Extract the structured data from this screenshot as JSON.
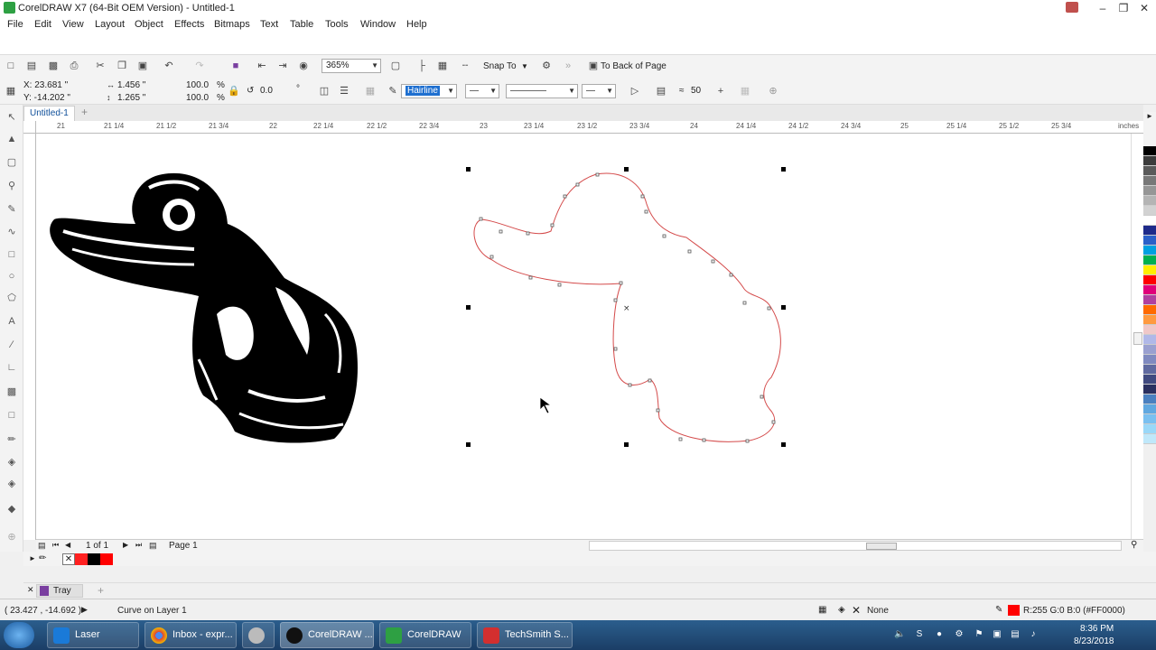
{
  "window": {
    "title": "CorelDRAW X7 (64-Bit OEM Version) - Untitled-1"
  },
  "menu": [
    "File",
    "Edit",
    "View",
    "Layout",
    "Object",
    "Effects",
    "Bitmaps",
    "Text",
    "Table",
    "Tools",
    "Window",
    "Help"
  ],
  "toolbar": {
    "zoom": "365%",
    "snap_to": "Snap To",
    "to_back": "To Back of Page"
  },
  "property_bar": {
    "x": "X: 23.681 \"",
    "y": "Y: -14.202 \"",
    "w": "1.456 \"",
    "h": "1.265 \"",
    "scale_x": "100.0",
    "scale_y": "100.0",
    "pct": "%",
    "rotation": "0.0",
    "deg": "°",
    "outline_width": "Hairline",
    "smooth": "50"
  },
  "doc_tab": "Untitled-1",
  "ruler": {
    "h_ticks": [
      "21",
      "21 1/4",
      "21 1/2",
      "21 3/4",
      "22",
      "22 1/4",
      "22 1/2",
      "22 3/4",
      "23",
      "23 1/4",
      "23 1/2",
      "23 3/4",
      "24",
      "24 1/4",
      "24 1/2",
      "24 3/4",
      "25",
      "25 1/4",
      "25 1/2",
      "25 3/4"
    ],
    "unit": "inches"
  },
  "page_nav": {
    "counter": "1 of 1",
    "page": "Page 1"
  },
  "tray": {
    "label": "Tray"
  },
  "status": {
    "coords": "( 23.427 , -14.692 )",
    "object": "Curve on Layer 1",
    "fill": "None",
    "outline": "R:255 G:0 B:0 (#FF0000)"
  },
  "taskbar": {
    "items": [
      "Laser Engravi...",
      "Inbox - expr...",
      "CorelDRAW ...",
      "CorelDRAW ...",
      "TechSmith S..."
    ],
    "time": "8:36 PM",
    "date": "8/23/2018"
  },
  "colors": {
    "accent": "#0f4f9a",
    "outline": "#d44a4a",
    "palette": [
      "#000000",
      "#3c3c3c",
      "#5a5a5a",
      "#787878",
      "#969696",
      "#b4b4b4",
      "#d2d2d2",
      "#ffffff",
      "#1e2a8a",
      "#2a60c8",
      "#00a0e0",
      "#00b050",
      "#ffee00",
      "#ff0000",
      "#e0007a",
      "#b040a0",
      "#ff6a00",
      "#ff9a40",
      "#f0c8c8",
      "#b0b8e8",
      "#9aa0d0",
      "#808ac0",
      "#606aa0",
      "#404a80",
      "#2a3060",
      "#4a80c0",
      "#60a8e0",
      "#7ac0f0",
      "#9ad8f8",
      "#c0e8fa"
    ]
  }
}
